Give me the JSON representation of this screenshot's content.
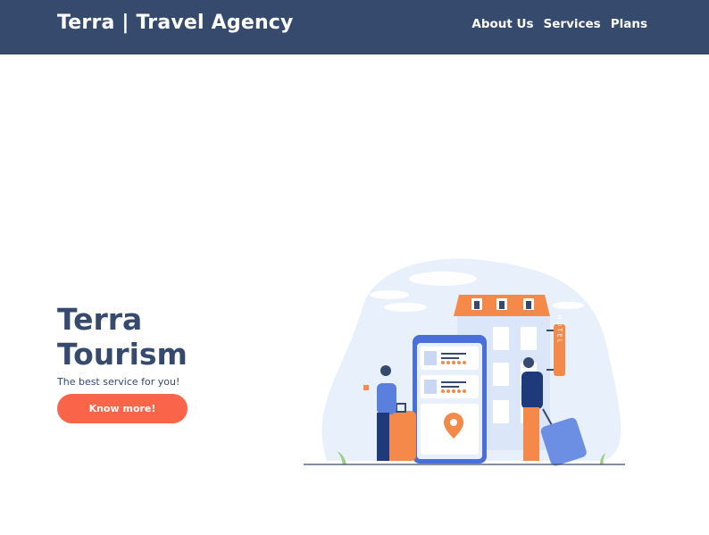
{
  "navbar": {
    "brand": "Terra | Travel Agency",
    "links": [
      "About Us",
      "Services",
      "Plans"
    ]
  },
  "hero": {
    "title_line1": "Terra",
    "title_line2": "Tourism",
    "subtitle": "The best service for you!",
    "cta_label": "Know more!"
  },
  "illustration": {
    "hotel_sign": "HOTEL"
  },
  "colors": {
    "navbar": "#364a6e",
    "heading": "#364a6e",
    "accent": "#fa6449",
    "illustration_blob": "#e8f0fb",
    "phone": "#4a6fd8",
    "orange": "#f5894a"
  }
}
